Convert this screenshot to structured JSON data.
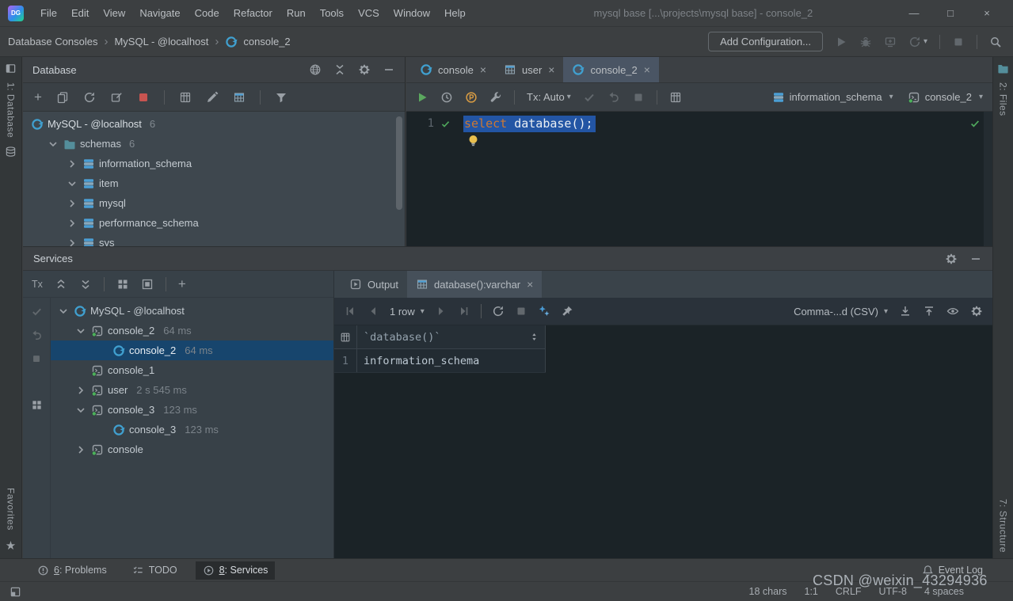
{
  "glyphs": {
    "separator": "›",
    "close": "×",
    "minimize": "—",
    "maximize": "□",
    "close_window": "×",
    "dropdown": "▾",
    "plus": "+",
    "star": "★"
  },
  "window": {
    "logo": "DG",
    "menu": [
      "File",
      "Edit",
      "View",
      "Navigate",
      "Code",
      "Refactor",
      "Run",
      "Tools",
      "VCS",
      "Window",
      "Help"
    ],
    "title": "mysql base [...\\projects\\mysql base] - console_2"
  },
  "run_bar": {
    "breadcrumbs": [
      "Database Consoles",
      "MySQL - @localhost",
      "console_2"
    ],
    "add_configuration": "Add Configuration..."
  },
  "stripes": {
    "left_top": "1: Database",
    "left_bottom": "Favorites",
    "right_top": "2: Files",
    "right_bottom": "7: Structure"
  },
  "database": {
    "title": "Database",
    "tree": [
      {
        "label": "MySQL - @localhost",
        "badge": "6"
      },
      {
        "label": "schemas",
        "badge": "6"
      },
      {
        "label": "information_schema",
        "badge": ""
      },
      {
        "label": "item",
        "badge": ""
      },
      {
        "label": "mysql",
        "badge": ""
      },
      {
        "label": "performance_schema",
        "badge": ""
      },
      {
        "label": "sys",
        "badge": ""
      }
    ]
  },
  "editor": {
    "tabs": [
      "console",
      "user",
      "console_2"
    ],
    "tx_mode": "Tx: Auto",
    "schema_selector": "information_schema",
    "console_selector": "console_2",
    "line_number": "1",
    "keyword": "select",
    "code_rest": " database();"
  },
  "services": {
    "title": "Services",
    "tx": "Tx",
    "tree": [
      {
        "label": "MySQL - @localhost",
        "time": ""
      },
      {
        "label": "console_2",
        "time": "64 ms"
      },
      {
        "label": "console_2",
        "time": "64 ms"
      },
      {
        "label": "console_1",
        "time": ""
      },
      {
        "label": "user",
        "time": "2 s 545 ms"
      },
      {
        "label": "console_3",
        "time": "123 ms"
      },
      {
        "label": "console_3",
        "time": "123 ms"
      },
      {
        "label": "console",
        "time": ""
      }
    ]
  },
  "output": {
    "tab_output": "Output",
    "tab_result": "database():varchar",
    "pager": "1 row",
    "format": "Comma-...d (CSV)",
    "grid_header": "`database()`",
    "rows": [
      {
        "num": "1",
        "value": "information_schema"
      }
    ]
  },
  "bottom": {
    "problems_mnemonic": "6",
    "problems_rest": ": Problems",
    "todo": "TODO",
    "services_mnemonic": "8",
    "services_rest": ": Services",
    "event_log": "Event Log",
    "chars": "18 chars",
    "position": "1:1",
    "line_sep": "CRLF",
    "encoding": "UTF-8",
    "indent": "4 spaces",
    "watermark": "CSDN @weixin_43294936"
  }
}
